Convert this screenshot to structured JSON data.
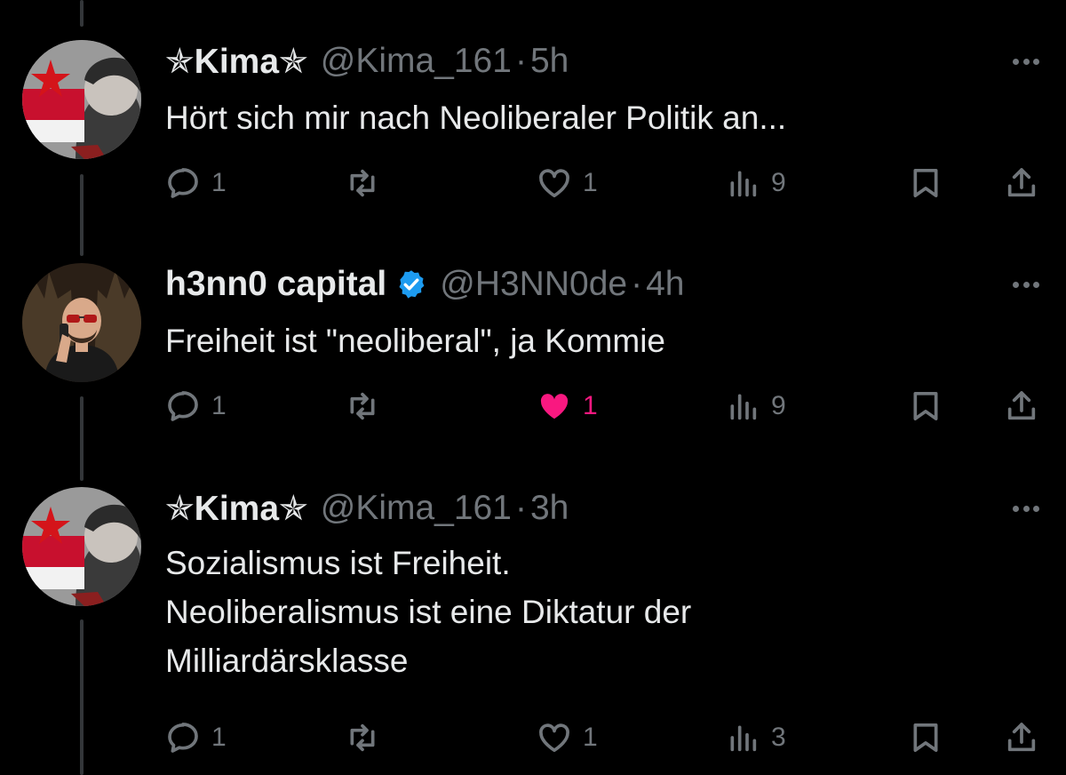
{
  "tweets": [
    {
      "name": "✯Kima✯",
      "handle": "@Kima_161",
      "time": "5h",
      "text": "Hört sich mir nach Neoliberaler Politik an...",
      "verified": false,
      "avatar_icon": "kima-avatar",
      "replies": "1",
      "retweets": "",
      "likes": "1",
      "liked": false,
      "views": "9"
    },
    {
      "name": "h3nn0 capital",
      "handle": "@H3NN0de",
      "time": "4h",
      "text": "Freiheit ist \"neoliberal\", ja Kommie",
      "verified": true,
      "avatar_icon": "henno-avatar",
      "replies": "1",
      "retweets": "",
      "likes": "1",
      "liked": true,
      "views": "9"
    },
    {
      "name": "✯Kima✯",
      "handle": "@Kima_161",
      "time": "3h",
      "text": "Sozialismus ist Freiheit.\nNeoliberalismus ist eine Diktatur der\nMilliardärsklasse",
      "verified": false,
      "avatar_icon": "kima-avatar",
      "replies": "1",
      "retweets": "",
      "likes": "1",
      "liked": false,
      "views": "3"
    }
  ],
  "separator": "·",
  "colors": {
    "background": "#000000",
    "text": "#e7e9ea",
    "muted": "#71767b",
    "like": "#f91880",
    "verified": "#1d9bf0"
  }
}
